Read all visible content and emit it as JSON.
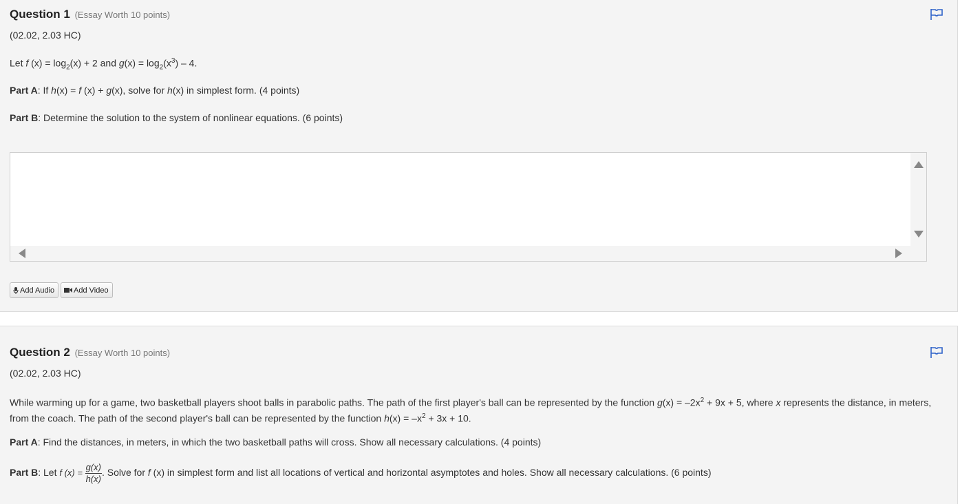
{
  "q1": {
    "title": "Question 1",
    "worth": "(Essay Worth 10 points)",
    "code": "(02.02, 2.03 HC)",
    "stmt": {
      "let": "Let ",
      "f": "f",
      "fx": " (x) = log",
      "sub1": "2",
      "x1": "(x) + 2 and ",
      "g": "g",
      "gx": "(x) = log",
      "sub2": "2",
      "x2": "(x",
      "sup": "3",
      "end": ") – 4."
    },
    "partA": {
      "label": "Part A",
      "t1": ": If ",
      "h": "h",
      "t2": "(x) = ",
      "f": "f",
      "t3": " (x) + ",
      "g": "g",
      "t4": "(x), solve for ",
      "h2": "h",
      "t5": "(x) in simplest form. (4 points)"
    },
    "partB": {
      "label": "Part B",
      "text": ": Determine the solution to the system of nonlinear equations. (6 points)"
    },
    "buttons": {
      "audio": "Add Audio",
      "video": "Add Video"
    }
  },
  "q2": {
    "title": "Question 2",
    "worth": "(Essay Worth 10 points)",
    "code": "(02.02, 2.03 HC)",
    "desc": {
      "t1": "While warming up for a game, two basketball players shoot balls in parabolic paths. The path of the first player's ball can be represented by the function ",
      "g": "g",
      "t2": "(x) = –2x",
      "sup1": "2",
      "t3": " + 9x + 5, where ",
      "x": "x",
      "t4": " represents the distance, in meters, from the coach. The path of the second player's ball can be represented by the function ",
      "h": "h",
      "t5": "(x) = –x",
      "sup2": "2",
      "t6": " + 3x + 10."
    },
    "partA": {
      "label": "Part A",
      "text": ": Find the distances, in meters, in which the two basketball paths will cross. Show all necessary calculations. (4 points)"
    },
    "partB": {
      "label": "Part B",
      "t1": ": Let ",
      "fx": "f (x) = ",
      "num": "g(x)",
      "den": "h(x)",
      "t2": ". Solve for ",
      "f": "f",
      "t3": " (x) in simplest form and list all locations of vertical and horizontal asymptotes and holes. Show all necessary calculations. (6 points)"
    }
  },
  "colors": {
    "flag": "#2f63c9"
  }
}
